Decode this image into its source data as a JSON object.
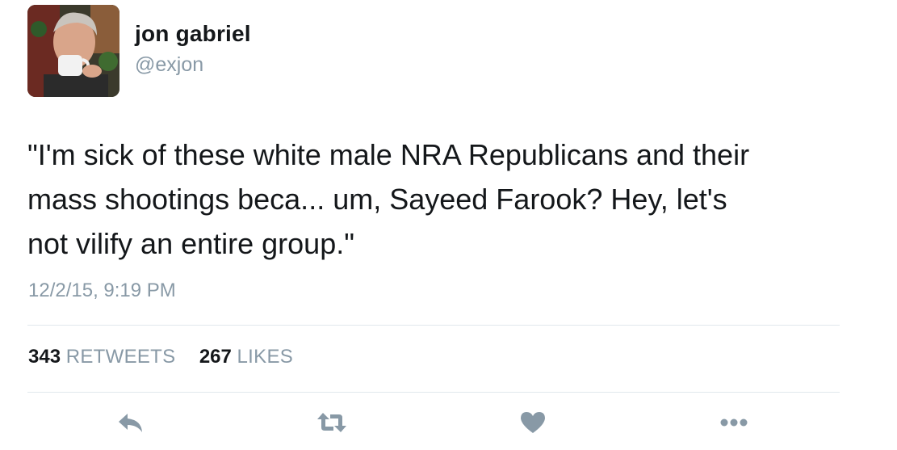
{
  "author": {
    "display_name": "jon gabriel",
    "handle": "@exjon"
  },
  "tweet": {
    "text": "\"I'm sick of these white male NRA Republicans and their\nmass shootings beca... um, Sayeed Farook? Hey, let's\nnot vilify an entire group.\"",
    "timestamp": "12/2/15, 9:19 PM"
  },
  "stats": {
    "retweets_count": "343",
    "retweets_label": "RETWEETS",
    "likes_count": "267",
    "likes_label": "LIKES"
  },
  "actions": {
    "reply_icon": "reply-icon",
    "retweet_icon": "retweet-icon",
    "like_icon": "heart-icon",
    "more_icon": "more-icon"
  },
  "colors": {
    "text": "#14171a",
    "secondary": "#8899a6",
    "icon": "#8899a6",
    "divider": "#e1e8ed"
  }
}
